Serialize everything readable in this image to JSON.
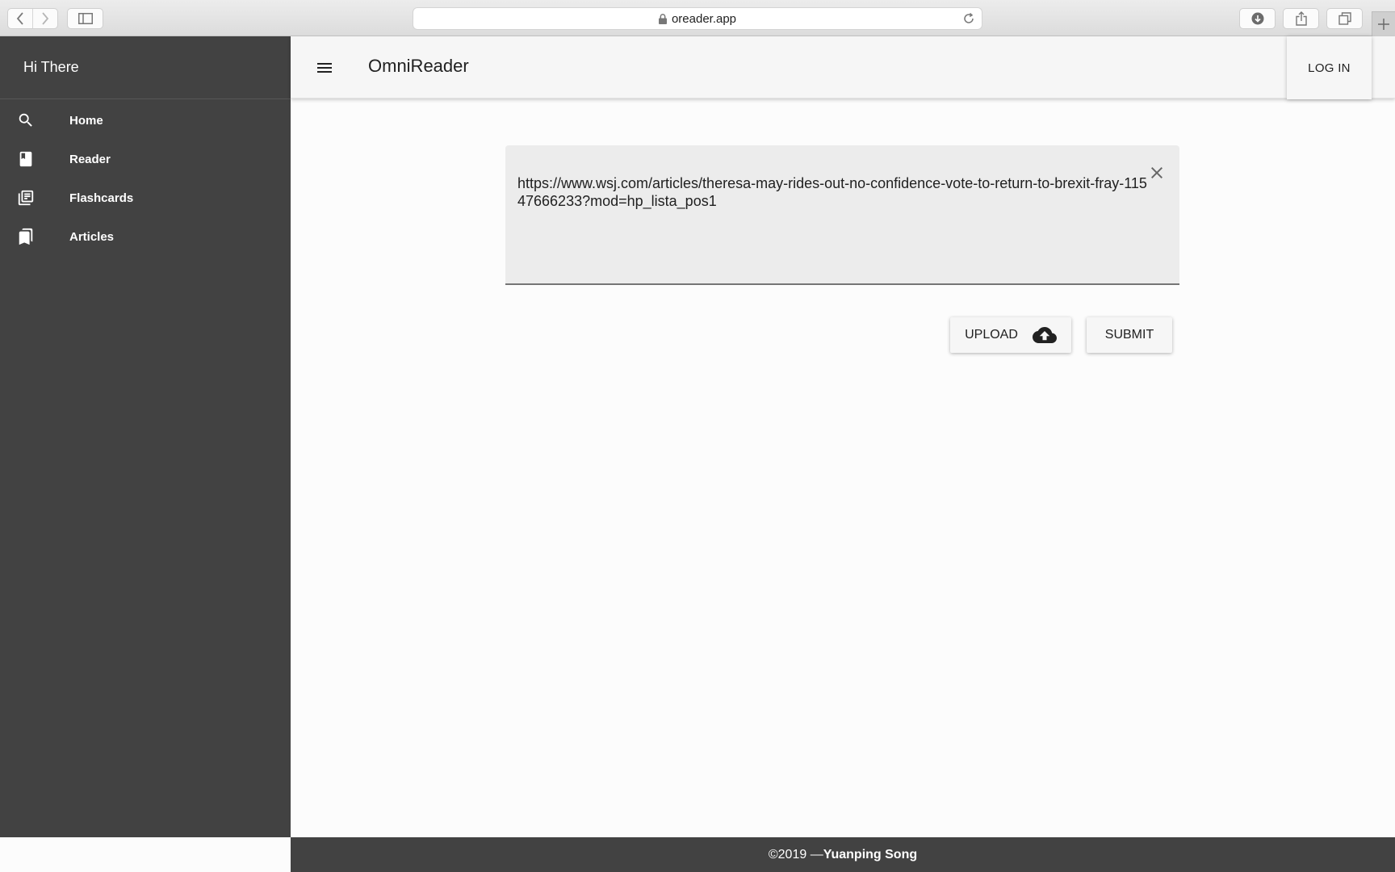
{
  "browser": {
    "url": "oreader.app"
  },
  "drawer": {
    "greeting": "Hi There",
    "items": [
      {
        "label": "Home",
        "icon": "search-icon"
      },
      {
        "label": "Reader",
        "icon": "book-icon"
      },
      {
        "label": "Flashcards",
        "icon": "library-books-icon"
      },
      {
        "label": "Articles",
        "icon": "bookmarks-icon"
      }
    ]
  },
  "appbar": {
    "title": "OmniReader",
    "login_label": "LOG IN"
  },
  "main": {
    "url_value": "https://www.wsj.com/articles/theresa-may-rides-out-no-confidence-vote-to-return-to-brexit-fray-11547666233?mod=hp_lista_pos1",
    "upload_label": "UPLOAD",
    "submit_label": "SUBMIT"
  },
  "footer": {
    "copyright": "©2019 —",
    "author": "Yuanping Song"
  },
  "colors": {
    "drawer_bg": "#424242",
    "appbar_bg": "#f6f6f6",
    "textarea_bg": "#ececec",
    "text": "#212121"
  }
}
